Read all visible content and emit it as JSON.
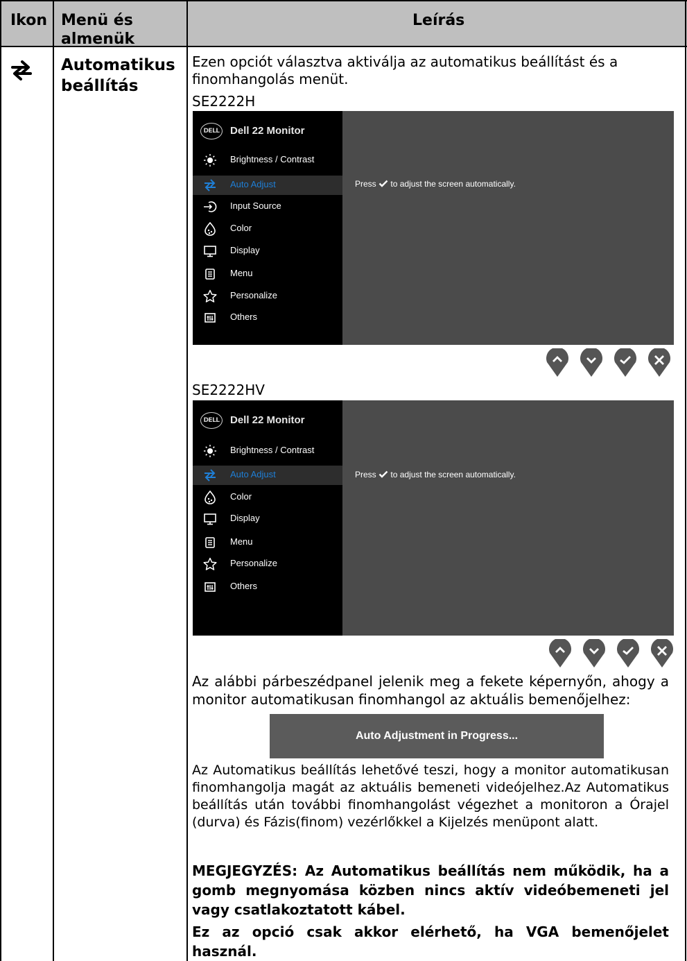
{
  "table": {
    "headers": {
      "icon": "Ikon",
      "menu_line1": "Menü és",
      "menu_line2": "almenük",
      "description": "Leírás"
    }
  },
  "row": {
    "icon": "auto-adjust-icon",
    "menu_line1": "Automatikus",
    "menu_line2": "beállítás",
    "intro": "Ezen opciót választva aktiválja az automatikus beállítást és a finomhangolás menüt.",
    "model1": "SE2222H",
    "model2": "SE2222HV",
    "dialog_text": "Az alábbi párbeszédpanel jelenik meg a fekete képernyőn, ahogy a monitor automatikusan finomhangol az aktuális bemenőjelhez:",
    "description": "Az Automatikus beállítás lehetővé teszi, hogy a monitor automatikusan finomhangolja magát az aktuális bemeneti videójelhez.Az Automatikus beállítás után további finomhangolást végezhet a monitoron a Órajel (durva) és Fázis(finom) vezérlőkkel a Kijelzés menüpont alatt.",
    "note1": "MEGJEGYZÉS: Az Automatikus beállítás nem működik, ha a gomb megnyomása közben nincs aktív videóbemeneti jel vagy csatlakoztatott kábel.",
    "note2": "Ez az opció csak akkor elérhető, ha VGA bemenőjelet használ."
  },
  "osd1": {
    "logo": "DELL",
    "title": "Dell 22 Monitor",
    "items": [
      {
        "label": "Brightness / Contrast",
        "icon": "brightness-icon"
      },
      {
        "label": "Auto Adjust",
        "icon": "auto-adjust-icon",
        "selected": true
      },
      {
        "label": "Input Source",
        "icon": "input-source-icon"
      },
      {
        "label": "Color",
        "icon": "color-icon"
      },
      {
        "label": "Display",
        "icon": "display-icon"
      },
      {
        "label": "Menu",
        "icon": "menu-icon"
      },
      {
        "label": "Personalize",
        "icon": "star-icon"
      },
      {
        "label": "Others",
        "icon": "others-icon"
      }
    ],
    "message_pre": "Press",
    "message_post": "to adjust the screen automatically.",
    "buttons": [
      "up-icon",
      "down-icon",
      "check-icon",
      "close-icon"
    ]
  },
  "osd2": {
    "logo": "DELL",
    "title": "Dell 22 Monitor",
    "items": [
      {
        "label": "Brightness / Contrast",
        "icon": "brightness-icon"
      },
      {
        "label": "Auto Adjust",
        "icon": "auto-adjust-icon",
        "selected": true
      },
      {
        "label": "Color",
        "icon": "color-icon"
      },
      {
        "label": "Display",
        "icon": "display-icon"
      },
      {
        "label": "Menu",
        "icon": "menu-icon"
      },
      {
        "label": "Personalize",
        "icon": "star-icon"
      },
      {
        "label": "Others",
        "icon": "others-icon"
      }
    ],
    "message_pre": "Press",
    "message_post": "to adjust the screen automatically.",
    "buttons": [
      "up-icon",
      "down-icon",
      "check-icon",
      "close-icon"
    ]
  },
  "progress_dialog": {
    "text": "Auto Adjustment in Progress..."
  },
  "colors": {
    "header_bg": "#bfbfbf",
    "osd_bg": "#4b4b4b",
    "osd_menu_bg": "#000000",
    "selected_text": "#1f7fd6"
  }
}
